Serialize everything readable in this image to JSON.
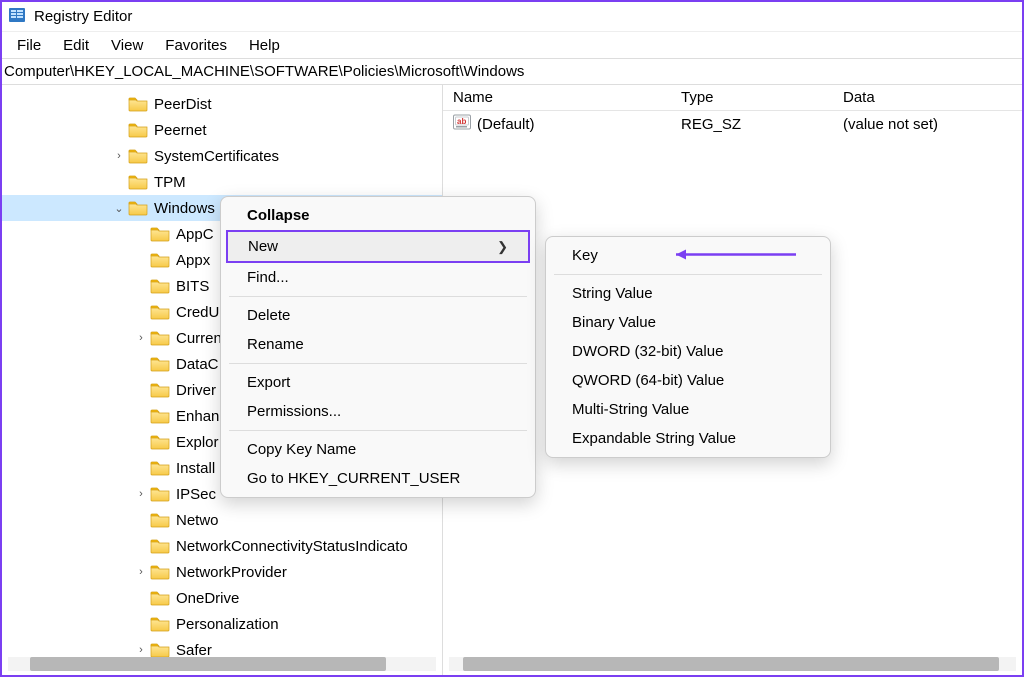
{
  "window": {
    "title": "Registry Editor"
  },
  "menu": {
    "file": "File",
    "edit": "Edit",
    "view": "View",
    "favorites": "Favorites",
    "help": "Help"
  },
  "address": "Computer\\HKEY_LOCAL_MACHINE\\SOFTWARE\\Policies\\Microsoft\\Windows",
  "tree": {
    "items": [
      {
        "indent": 124,
        "label": "PeerDist",
        "expander": ""
      },
      {
        "indent": 124,
        "label": "Peernet",
        "expander": ""
      },
      {
        "indent": 124,
        "label": "SystemCertificates",
        "expander": ">"
      },
      {
        "indent": 124,
        "label": "TPM",
        "expander": ""
      },
      {
        "indent": 124,
        "label": "Windows",
        "expander": "v",
        "selected": true
      },
      {
        "indent": 146,
        "label": "AppCompat",
        "expander": "",
        "clip": "AppC"
      },
      {
        "indent": 146,
        "label": "Appx",
        "expander": ""
      },
      {
        "indent": 146,
        "label": "BITS",
        "expander": ""
      },
      {
        "indent": 146,
        "label": "CredUI",
        "expander": "",
        "clip": "CredU"
      },
      {
        "indent": 146,
        "label": "CurrentVersion",
        "expander": ">",
        "clip": "Curren"
      },
      {
        "indent": 146,
        "label": "DataCollection",
        "expander": "",
        "clip": "DataC"
      },
      {
        "indent": 146,
        "label": "DriverInstall",
        "expander": "",
        "clip": "Driver"
      },
      {
        "indent": 146,
        "label": "EnhancedStorageDevices",
        "expander": "",
        "clip": "Enhan"
      },
      {
        "indent": 146,
        "label": "Explorer",
        "expander": "",
        "clip": "Explor"
      },
      {
        "indent": 146,
        "label": "Install",
        "expander": "",
        "clip": "Install"
      },
      {
        "indent": 146,
        "label": "IPSec",
        "expander": ">"
      },
      {
        "indent": 146,
        "label": "NetworkConnections",
        "expander": "",
        "clip": "Netwo"
      },
      {
        "indent": 146,
        "label": "NetworkConnectivityStatusIndicato",
        "expander": ""
      },
      {
        "indent": 146,
        "label": "NetworkProvider",
        "expander": ">"
      },
      {
        "indent": 146,
        "label": "OneDrive",
        "expander": ""
      },
      {
        "indent": 146,
        "label": "Personalization",
        "expander": ""
      },
      {
        "indent": 146,
        "label": "Safer",
        "expander": ">",
        "clip": "Safer"
      }
    ]
  },
  "list": {
    "header": {
      "name": "Name",
      "type": "Type",
      "data": "Data"
    },
    "rows": [
      {
        "name": "(Default)",
        "type": "REG_SZ",
        "data": "(value not set)"
      }
    ]
  },
  "context_menu": {
    "collapse": "Collapse",
    "new": "New",
    "find": "Find...",
    "delete": "Delete",
    "rename": "Rename",
    "export": "Export",
    "permissions": "Permissions...",
    "copy_key_name": "Copy Key Name",
    "goto_hkcu": "Go to HKEY_CURRENT_USER"
  },
  "new_submenu": {
    "key": "Key",
    "string": "String Value",
    "binary": "Binary Value",
    "dword": "DWORD (32-bit) Value",
    "qword": "QWORD (64-bit) Value",
    "multi": "Multi-String Value",
    "expand": "Expandable String Value"
  }
}
